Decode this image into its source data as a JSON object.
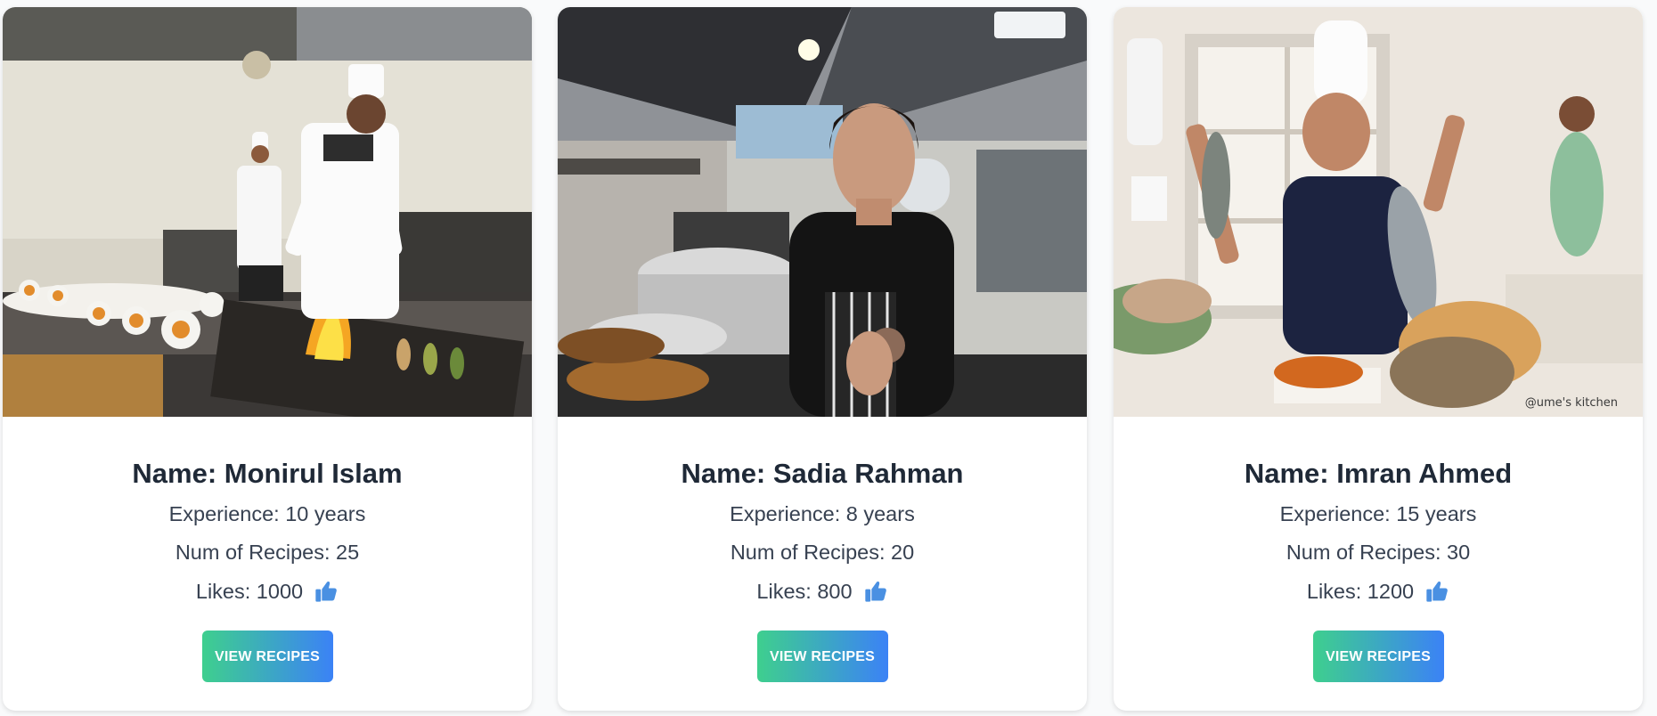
{
  "chefs": [
    {
      "name": "Name: Monirul Islam",
      "experience": "Experience: 10 years",
      "recipes": "Num of Recipes: 25",
      "likes": "Likes: 1000",
      "button_label": "VIEW RECIPES",
      "photo_alt": "chef-grilling-photo"
    },
    {
      "name": "Name: Sadia Rahman",
      "experience": "Experience: 8 years",
      "recipes": "Num of Recipes: 20",
      "likes": "Likes: 800",
      "button_label": "VIEW RECIPES",
      "photo_alt": "chef-kitchen-photo"
    },
    {
      "name": "Name: Imran Ahmed",
      "experience": "Experience: 15 years",
      "recipes": "Num of Recipes: 30",
      "likes": "Likes: 1200",
      "button_label": "VIEW RECIPES",
      "photo_alt": "chef-fish-photo",
      "watermark": "@ume's kitchen"
    }
  ],
  "icons": {
    "likes": "thumbs-up-icon"
  },
  "colors": {
    "button_gradient_start": "#3ecf8e",
    "button_gradient_end": "#3b82f6",
    "thumb": "#4a90e2",
    "card_bg": "#ffffff"
  }
}
